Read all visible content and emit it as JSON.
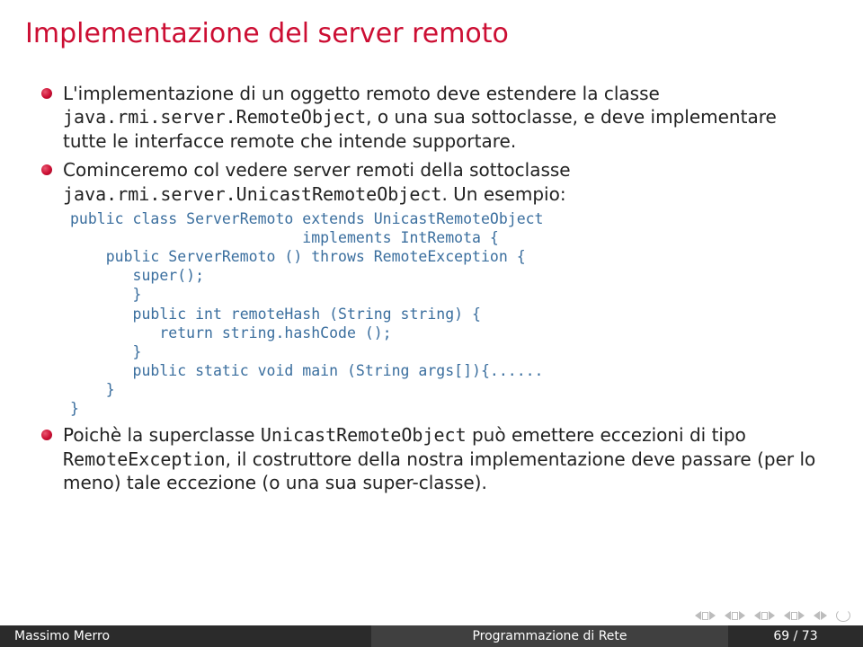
{
  "title": "Implementazione del server remoto",
  "bullets": {
    "b1_pre": "L'implementazione di un oggetto remoto deve estendere la classe ",
    "b1_tt1": "java.rmi.server.RemoteObject",
    "b1_post": ", o una sua sottoclasse, e deve implementare tutte le interfacce remote che intende supportare.",
    "b2_pre": "Cominceremo col vedere server remoti della sottoclasse ",
    "b2_tt1": "java.rmi.server.UnicastRemoteObject",
    "b2_post": ". Un esempio:",
    "b3_pre": "Poichè la superclasse ",
    "b3_tt1": "UnicastRemoteObject",
    "b3_mid": " può emettere eccezioni di tipo ",
    "b3_tt2": "RemoteException",
    "b3_post": ", il costruttore della nostra implementazione deve passare (per lo meno) tale eccezione (o una sua super-classe)."
  },
  "code": "public class ServerRemoto extends UnicastRemoteObject\n                          implements IntRemota {\n    public ServerRemoto () throws RemoteException {\n       super();\n       }\n       public int remoteHash (String string) {\n          return string.hashCode ();\n       }\n       public static void main (String args[]){......\n    }\n}",
  "footer": {
    "author": "Massimo Merro",
    "course": "Programmazione di Rete",
    "page": "69 / 73"
  }
}
